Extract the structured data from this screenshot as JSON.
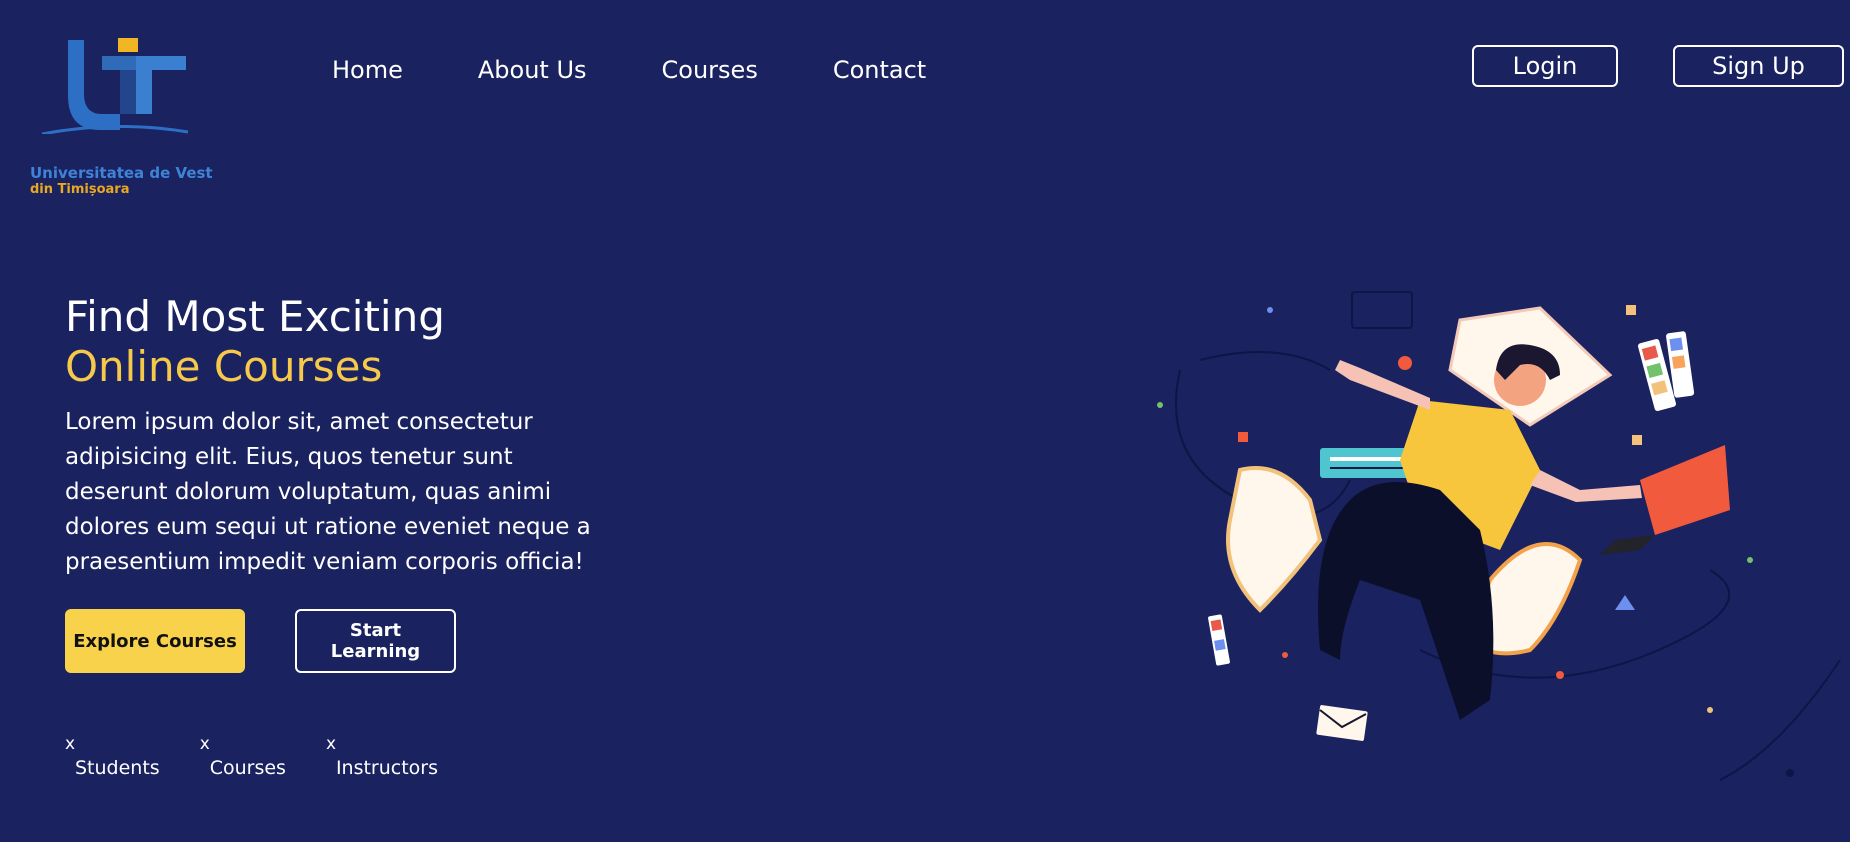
{
  "header": {
    "logo": {
      "text_line1": "Universitatea de Vest",
      "text_line2": "din Timișoara",
      "colors": {
        "blue": "#2d6fc4",
        "gold": "#f0b624"
      }
    },
    "nav": [
      {
        "label": "Home"
      },
      {
        "label": "About Us"
      },
      {
        "label": "Courses"
      },
      {
        "label": "Contact"
      }
    ],
    "login_label": "Login",
    "signup_label": "Sign Up"
  },
  "hero": {
    "title_line1": "Find Most Exciting",
    "title_line2": "Online Courses",
    "description": "Lorem ipsum dolor sit, amet consectetur adipisicing elit. Eius, quos tenetur sunt deserunt dolorum voluptatum, quas animi dolores eum sequi ut ratione eveniet neque a praesentium impedit veniam corporis officia!",
    "primary_button": "Explore Courses",
    "secondary_button": "Start Learning",
    "stats": [
      {
        "value": "x",
        "label": "Students"
      },
      {
        "value": "x",
        "label": "Courses"
      },
      {
        "value": "x",
        "label": "Instructors"
      }
    ]
  },
  "theme": {
    "background": "#1a2260",
    "accent": "#f8d24a",
    "text": "#ffffff"
  },
  "illustration": {
    "icon": "person-juggling-documents-illustration"
  }
}
